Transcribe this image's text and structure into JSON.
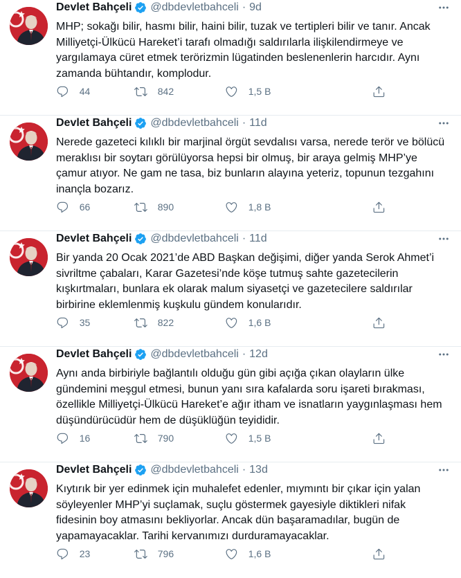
{
  "tweets": [
    {
      "name": "Devlet Bahçeli",
      "handle": "@dbdevletbahceli",
      "separator": "·",
      "time": "9d",
      "text": "MHP; sokağı bilir, hasmı bilir, haini bilir, tuzak ve tertipleri bilir ve tanır. Ancak Milliyetçi-Ülkücü Hareket’i tarafı olmadığı saldırılarla ilişkilendirmeye ve yargılamaya cüret etmek terörizmin lügatinden beslenenlerin harcıdır. Aynı zamanda bühtandır, komplodur.",
      "replies": "44",
      "retweets": "842",
      "likes": "1,5 B"
    },
    {
      "name": "Devlet Bahçeli",
      "handle": "@dbdevletbahceli",
      "separator": "·",
      "time": "11d",
      "text": "Nerede gazeteci kılıklı bir marjinal örgüt sevdalısı varsa, nerede terör ve bölücü meraklısı bir soytarı görülüyorsa hepsi bir olmuş, bir araya gelmiş MHP’ye çamur atıyor. Ne gam ne tasa, biz bunların alayına yeteriz, topunun tezgahını inançla bozarız.",
      "replies": "66",
      "retweets": "890",
      "likes": "1,8 B"
    },
    {
      "name": "Devlet Bahçeli",
      "handle": "@dbdevletbahceli",
      "separator": "·",
      "time": "11d",
      "text": "Bir yanda 20 Ocak 2021’de ABD Başkan değişimi, diğer yanda Serok Ahmet’i sivriltme çabaları, Karar Gazetesi’nde köşe tutmuş sahte gazetecilerin kışkırtmaları, bunlara ek olarak malum siyasetçi ve gazetecilere saldırılar birbirine eklemlenmiş kuşkulu gündem konularıdır.",
      "replies": "35",
      "retweets": "822",
      "likes": "1,6 B"
    },
    {
      "name": "Devlet Bahçeli",
      "handle": "@dbdevletbahceli",
      "separator": "·",
      "time": "12d",
      "text": "Aynı anda birbiriyle bağlantılı olduğu gün gibi açığa çıkan olayların ülke gündemini meşgul etmesi, bunun yanı sıra kafalarda soru işareti bırakması, özellikle Milliyetçi-Ülkücü Hareket’e ağır itham ve isnatların yaygınlaşması hem düşündürücüdür hem de düşüklüğün teyididir.",
      "replies": "16",
      "retweets": "790",
      "likes": "1,5 B"
    },
    {
      "name": "Devlet Bahçeli",
      "handle": "@dbdevletbahceli",
      "separator": "·",
      "time": "13d",
      "text": "Kıytırık bir yer edinmek için muhalefet edenler, mıymıntı bir çıkar için yalan söyleyenler MHP’yi suçlamak, suçlu göstermek gayesiyle diktikleri nifak fidesinin boy atmasını bekliyorlar. Ancak dün başaramadılar, bugün de yapamayacaklar. Tarihi kervanımızı durduramayacaklar.",
      "replies": "23",
      "retweets": "796",
      "likes": "1,6 B"
    }
  ],
  "icons": {
    "avatar": "profile-photo",
    "verified": "verified-badge-icon",
    "more": "more-options-icon",
    "reply": "reply-icon",
    "retweet": "retweet-icon",
    "like": "like-heart-icon",
    "share": "share-icon"
  },
  "colors": {
    "text": "#0f1419",
    "secondary": "#5b7083",
    "verified": "#1da1f2",
    "divider": "#e6ecf0",
    "avatar_bg": "#c9242f"
  }
}
